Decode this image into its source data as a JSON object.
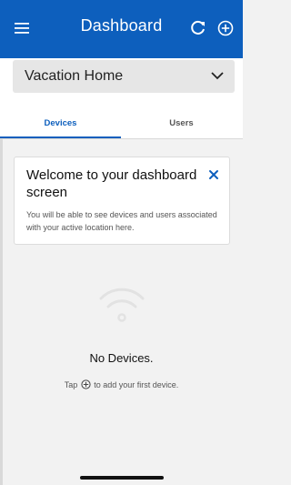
{
  "header": {
    "title": "Dashboard",
    "menu_icon": "hamburger-menu-icon",
    "refresh_icon": "refresh-icon",
    "add_icon": "add-circle-icon"
  },
  "location": {
    "selected": "Vacation Home",
    "icon": "chevron-down-icon"
  },
  "tabs": [
    {
      "label": "Devices",
      "active": true
    },
    {
      "label": "Users",
      "active": false
    }
  ],
  "welcome_card": {
    "title": "Welcome to your dashboard screen",
    "body": "You will be able to see devices and users associated with your active location here.",
    "close_icon": "close-icon"
  },
  "empty_state": {
    "icon": "wifi-icon",
    "title": "No Devices.",
    "subtitle_before": "Tap",
    "subtitle_after": "to add your first device.",
    "inline_icon": "add-circle-icon"
  },
  "colors": {
    "primary": "#0d5fbd",
    "header_text": "#ffffff",
    "background": "#f2f2f2"
  }
}
